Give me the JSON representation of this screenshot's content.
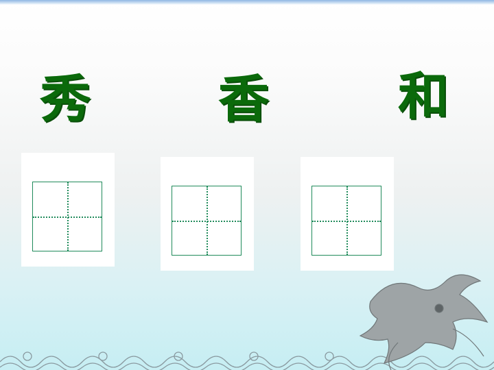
{
  "characters": [
    {
      "text": "秀"
    },
    {
      "text": "香"
    },
    {
      "text": "和"
    }
  ],
  "colors": {
    "character_green": "#0b6a0b",
    "grid_line": "#1f8a5a",
    "top_band_blue": "#8fb6e3",
    "bottom_tint": "#c6eef3"
  },
  "decorations": {
    "bottom_border": "wave-pattern",
    "corner_ornament": "dragon-ornament"
  },
  "practice_grids": {
    "count": 3,
    "style": "tian-zi-ge"
  }
}
